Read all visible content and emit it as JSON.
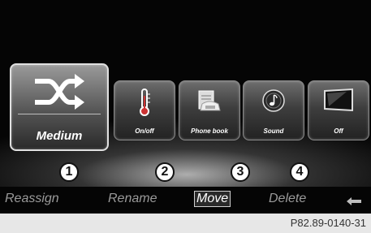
{
  "tiles": [
    {
      "label": "Medium",
      "icon": "shuffle-icon"
    },
    {
      "label": "On/off",
      "icon": "thermometer-icon"
    },
    {
      "label": "Phone book",
      "icon": "phone-book-icon"
    },
    {
      "label": "Sound",
      "icon": "music-note-icon"
    },
    {
      "label": "Off",
      "icon": "screen-icon"
    }
  ],
  "markers": [
    "1",
    "2",
    "3",
    "4"
  ],
  "softkeys": {
    "reassign": "Reassign",
    "rename": "Rename",
    "move": "Move",
    "delete": "Delete",
    "back_icon": "back-arrow-icon"
  },
  "caption": "P82.89-0140-31"
}
